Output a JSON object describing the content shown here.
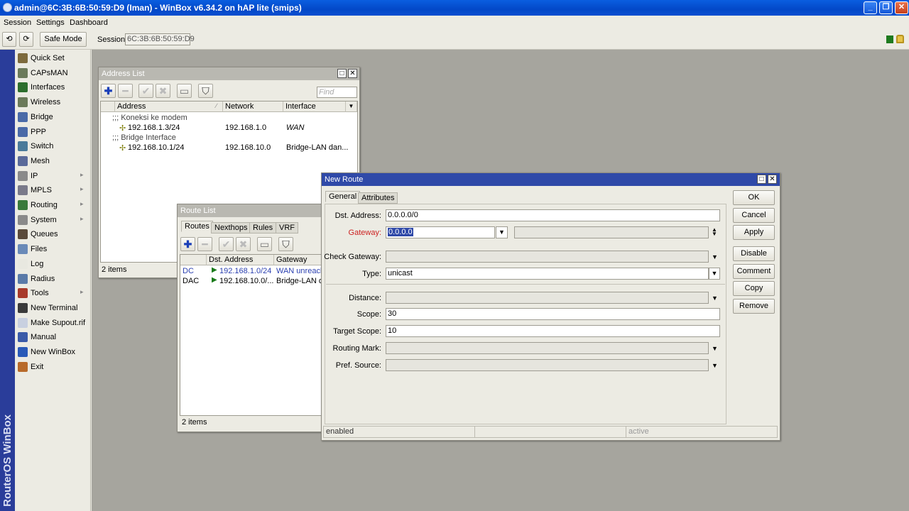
{
  "app": {
    "title": "admin@6C:3B:6B:50:59:D9 (Iman) - WinBox v6.34.2 on hAP lite (smips)"
  },
  "menu": [
    "Session",
    "Settings",
    "Dashboard"
  ],
  "toolbar": {
    "undo": "⟲",
    "redo": "⟳",
    "safe_mode": "Safe Mode",
    "session_label": "Session:",
    "session_value": "6C:3B:6B:50:59:D9"
  },
  "sidebar": {
    "brand": "RouterOS WinBox",
    "items": [
      {
        "label": "Quick Set",
        "icon": "quick-set-icon",
        "color": "#7d6a3c",
        "sub": false
      },
      {
        "label": "CAPsMAN",
        "icon": "capsman-icon",
        "color": "#6b7a5a",
        "sub": false
      },
      {
        "label": "Interfaces",
        "icon": "interfaces-icon",
        "color": "#2d6e2d",
        "sub": false
      },
      {
        "label": "Wireless",
        "icon": "wireless-icon",
        "color": "#6b7a5a",
        "sub": false
      },
      {
        "label": "Bridge",
        "icon": "bridge-icon",
        "color": "#4a6aa8",
        "sub": false
      },
      {
        "label": "PPP",
        "icon": "ppp-icon",
        "color": "#4a6aa8",
        "sub": false
      },
      {
        "label": "Switch",
        "icon": "switch-icon",
        "color": "#4a7a9a",
        "sub": false
      },
      {
        "label": "Mesh",
        "icon": "mesh-icon",
        "color": "#5a6a9a",
        "sub": false
      },
      {
        "label": "IP",
        "icon": "ip-icon",
        "color": "#8a8a8a",
        "sub": true
      },
      {
        "label": "MPLS",
        "icon": "mpls-icon",
        "color": "#7a7a8a",
        "sub": true
      },
      {
        "label": "Routing",
        "icon": "routing-icon",
        "color": "#3a7a3a",
        "sub": true
      },
      {
        "label": "System",
        "icon": "system-icon",
        "color": "#8a8a8a",
        "sub": true
      },
      {
        "label": "Queues",
        "icon": "queues-icon",
        "color": "#5a4a3a",
        "sub": false
      },
      {
        "label": "Files",
        "icon": "files-icon",
        "color": "#6a8ab8",
        "sub": false
      },
      {
        "label": "Log",
        "icon": "log-icon",
        "color": "#e8e8e0",
        "sub": false
      },
      {
        "label": "Radius",
        "icon": "radius-icon",
        "color": "#5a7aa8",
        "sub": false
      },
      {
        "label": "Tools",
        "icon": "tools-icon",
        "color": "#a83a2a",
        "sub": true
      },
      {
        "label": "New Terminal",
        "icon": "terminal-icon",
        "color": "#3a3a3a",
        "sub": false
      },
      {
        "label": "Make Supout.rif",
        "icon": "supout-icon",
        "color": "#c8d0e0",
        "sub": false
      },
      {
        "label": "Manual",
        "icon": "manual-icon",
        "color": "#3a5aa8",
        "sub": false
      },
      {
        "label": "New WinBox",
        "icon": "winbox-icon",
        "color": "#2a5ab8",
        "sub": false
      },
      {
        "label": "Exit",
        "icon": "exit-icon",
        "color": "#b86a2a",
        "sub": false
      }
    ]
  },
  "address_list": {
    "title": "Address List",
    "find_placeholder": "Find",
    "columns": [
      "Address",
      "Network",
      "Interface"
    ],
    "rows": [
      {
        "comment": ";;; Koneksi ke modem"
      },
      {
        "address": "192.168.1.3/24",
        "network": "192.168.1.0",
        "interface": "WAN"
      },
      {
        "comment": ";;; Bridge Interface"
      },
      {
        "address": "192.168.10.1/24",
        "network": "192.168.10.0",
        "interface": "Bridge-LAN dan..."
      }
    ],
    "footer": "2 items"
  },
  "route_list": {
    "title": "Route List",
    "tabs": [
      "Routes",
      "Nexthops",
      "Rules",
      "VRF"
    ],
    "columns": [
      "Dst. Address",
      "Gateway"
    ],
    "rows": [
      {
        "flag": "DC",
        "dst": "192.168.1.0/24",
        "gateway": "WAN unreach"
      },
      {
        "flag": "DAC",
        "dst": "192.168.10.0/...",
        "gateway": "Bridge-LAN da"
      }
    ],
    "footer": "2 items"
  },
  "new_route": {
    "title": "New Route",
    "tabs": [
      "General",
      "Attributes"
    ],
    "fields": {
      "dst_label": "Dst. Address:",
      "dst_value": "0.0.0.0/0",
      "gateway_label": "Gateway:",
      "gateway_value": "0.0.0.0",
      "check_gateway_label": "Check Gateway:",
      "type_label": "Type:",
      "type_value": "unicast",
      "distance_label": "Distance:",
      "scope_label": "Scope:",
      "scope_value": "30",
      "target_scope_label": "Target Scope:",
      "target_scope_value": "10",
      "routing_mark_label": "Routing Mark:",
      "pref_source_label": "Pref. Source:"
    },
    "buttons": [
      "OK",
      "Cancel",
      "Apply",
      "Disable",
      "Comment",
      "Copy",
      "Remove"
    ],
    "status": {
      "left": "enabled",
      "right": "active"
    }
  },
  "colors": {
    "title_active": "#2f49a8",
    "gateway_label": "#cc2222",
    "selection": "#2f49a8"
  }
}
